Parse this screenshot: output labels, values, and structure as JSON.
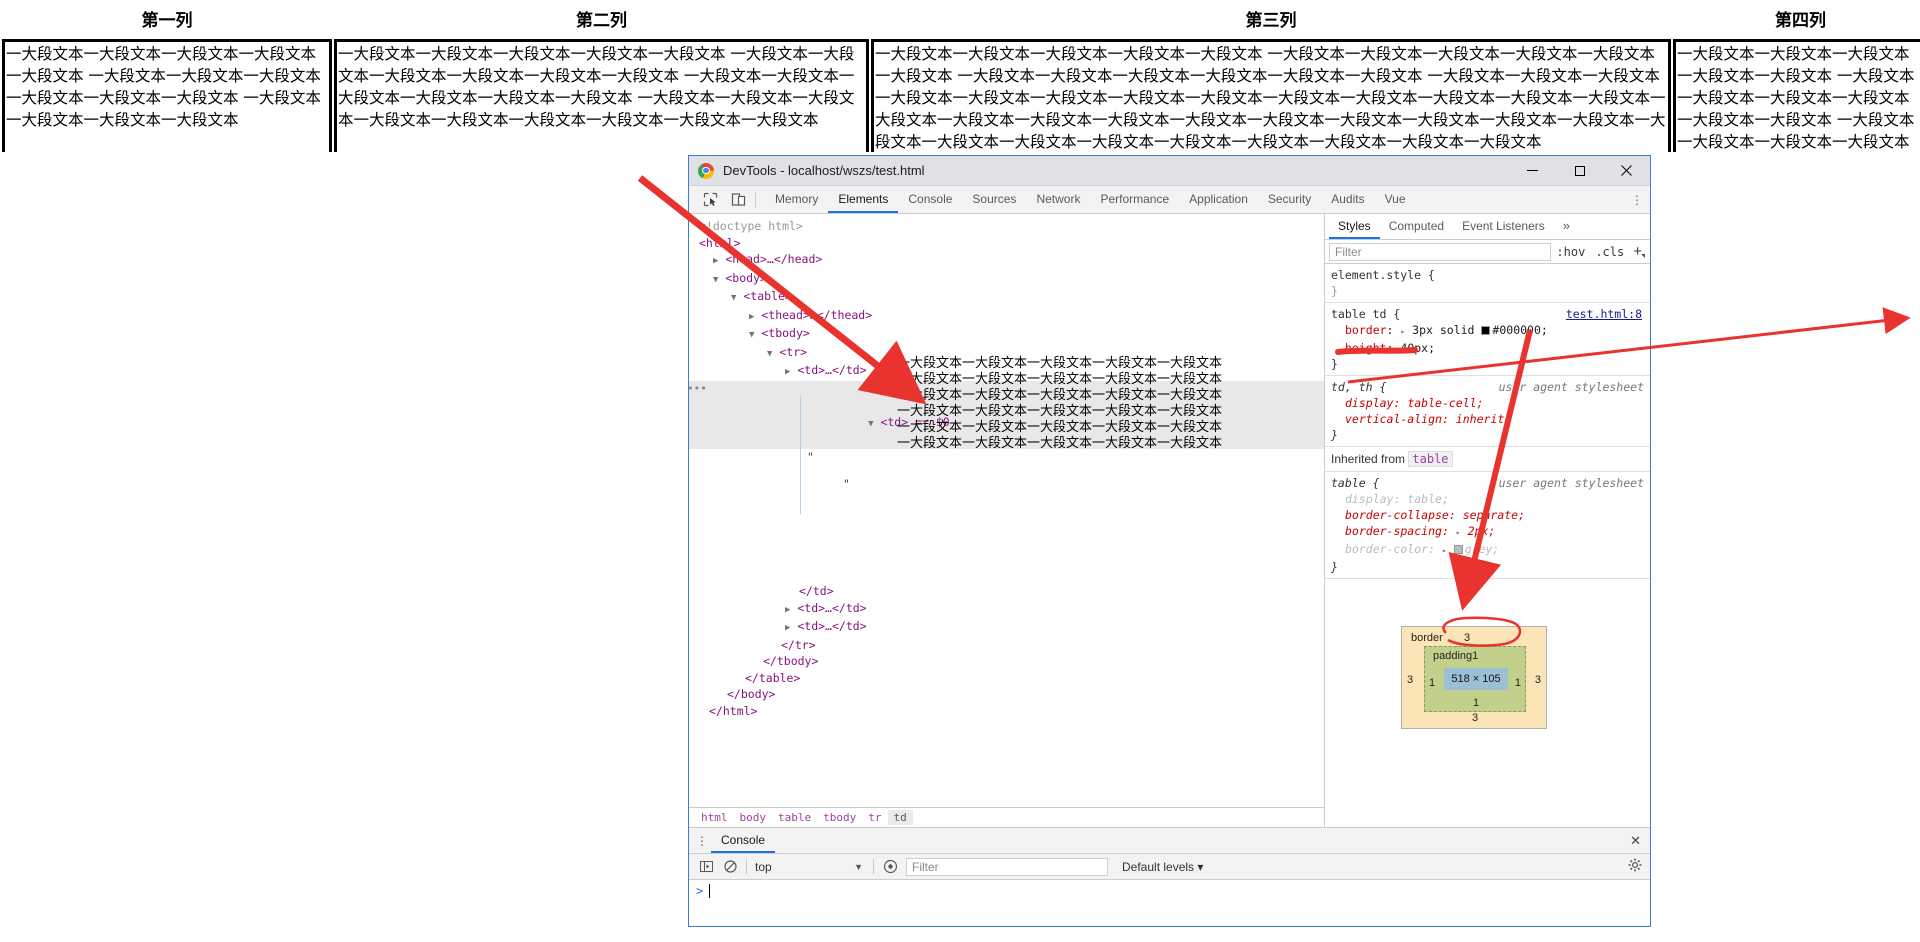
{
  "page": {
    "table": {
      "headers": [
        "第一列",
        "第二列",
        "第三列",
        "第四列"
      ],
      "cells": [
        "一大段文本一大段文本一大段文本一大段文本一大段文本 一大段文本一大段文本一大段文本一大段文本一大段文本一大段文本 一大段文本一大段文本一大段文本一大段文本",
        "一大段文本一大段文本一大段文本一大段文本一大段文本 一大段文本一大段文本一大段文本一大段文本一大段文本一大段文本 一大段文本一大段文本一大段文本一大段文本一大段文本一大段文本 一大段文本一大段文本一大段文本一大段文本一大段文本一大段文本一大段文本一大段文本一大段文本",
        "一大段文本一大段文本一大段文本一大段文本一大段文本 一大段文本一大段文本一大段文本一大段文本一大段文本一大段文本 一大段文本一大段文本一大段文本一大段文本一大段文本一大段文本 一大段文本一大段文本一大段文本一大段文本一大段文本一大段文本一大段文本一大段文本一大段文本一大段文本一大段文本一大段文本一大段文本一大段文本一大段文本一大段文本一大段文本一大段文本一大段文本一大段文本一大段文本一大段文本一大段文本一大段文本一大段文本一大段文本一大段文本一大段文本一大段文本一大段文本一大段文本一大段文本",
        "一大段文本一大段文本一大段文本一大段文本一大段文本 一大段文本一大段文本一大段文本一大段文本一大段文本一大段文本 一大段文本一大段文本一大段文本一大段文本"
      ]
    }
  },
  "devtools": {
    "window_title": "DevTools - localhost/wszs/test.html",
    "window_controls": {
      "minimize": "minimize-icon",
      "maximize": "maximize-icon",
      "close": "close-icon"
    },
    "toolbar_icons": [
      "inspect-element-icon",
      "device-toolbar-icon"
    ],
    "more_menu": "⋮",
    "tabs": [
      {
        "label": "Memory",
        "active": false
      },
      {
        "label": "Elements",
        "active": true
      },
      {
        "label": "Console",
        "active": false
      },
      {
        "label": "Sources",
        "active": false
      },
      {
        "label": "Network",
        "active": false
      },
      {
        "label": "Performance",
        "active": false
      },
      {
        "label": "Application",
        "active": false
      },
      {
        "label": "Security",
        "active": false
      },
      {
        "label": "Audits",
        "active": false
      },
      {
        "label": "Vue",
        "active": false
      }
    ],
    "dom_tree": {
      "lines": [
        "<!doctype html>",
        "<html>",
        "<head>…</head>",
        "<body>",
        "<table>",
        "<thead>…</thead>",
        "<tbody>",
        "<tr>",
        "<td>…</td>",
        "<td> == $0",
        "</td>",
        "<td>…</td>",
        "<td>…</td>",
        "</tr>",
        "</tbody>",
        "</table>",
        "</body>",
        "</html>"
      ],
      "selected_marker": "== $0",
      "text_node_quote": "\"",
      "text_node_lines": [
        "一大段文本一大段文本一大段文本一大段文本一大段文本",
        "一大段文本一大段文本一大段文本一大段文本一大段文本",
        "一大段文本一大段文本一大段文本一大段文本一大段文本",
        "一大段文本一大段文本一大段文本一大段文本一大段文本",
        "一大段文本一大段文本一大段文本一大段文本一大段文本",
        "一大段文本一大段文本一大段文本一大段文本一大段文本"
      ]
    },
    "breadcrumb": [
      "html",
      "body",
      "table",
      "tbody",
      "tr",
      "td"
    ],
    "styles": {
      "tabs": [
        "Styles",
        "Computed",
        "Event Listeners"
      ],
      "overflow_chevron": "»",
      "filter_placeholder": "Filter",
      "hov_label": ":hov",
      "cls_label": ".cls",
      "plus_label": "+",
      "rules": [
        {
          "selector": "element.style {",
          "source": "",
          "ua": "",
          "declarations": [],
          "close": "}"
        },
        {
          "selector": "table td {",
          "source": "test.html:8",
          "ua": "",
          "declarations": [
            {
              "prop": "border",
              "value": "3px solid",
              "color": "#000000",
              "toggle": "▸"
            },
            {
              "prop": "height",
              "value": "40px"
            }
          ],
          "close": "}"
        },
        {
          "selector": "td, th {",
          "source": "",
          "ua": "user agent stylesheet",
          "declarations": [
            {
              "prop": "display",
              "value": "table-cell"
            },
            {
              "prop": "vertical-align",
              "value": "inherit"
            }
          ],
          "close": "}"
        }
      ],
      "inherited_from_label": "Inherited from",
      "inherited_from_tag": "table",
      "inherited_rule": {
        "selector": "table {",
        "ua": "user agent stylesheet",
        "declarations": [
          {
            "prop": "display",
            "value": "table",
            "dimmed": true
          },
          {
            "prop": "border-collapse",
            "value": "separate"
          },
          {
            "prop": "border-spacing",
            "value": "2px",
            "toggle": "▸"
          },
          {
            "prop": "border-color",
            "value": "grey",
            "dimmed": true,
            "toggle": "▸"
          }
        ],
        "close": "}"
      }
    },
    "box_model": {
      "border_label": "border",
      "border_top": "3",
      "border_right": "3",
      "border_bottom": "3",
      "border_left": "3",
      "padding_label": "padding",
      "padding_top": "1",
      "padding_right": "1",
      "padding_bottom": "1",
      "padding_left": "1",
      "content_size": "518 × 105"
    },
    "drawer": {
      "tab_label": "Console",
      "dots": "⋮",
      "close": "✕",
      "context": "top",
      "filter_placeholder": "Filter",
      "levels": "Default levels",
      "levels_chevron": "▾",
      "prompt": ">"
    }
  },
  "colors": {
    "accent_blue": "#1a73e8",
    "titlebar": "#dfe1e5",
    "panel_bg": "#f3f3f3",
    "tag_purple": "#881280",
    "prop_red": "#c80000",
    "annotation_red": "#e03030"
  }
}
